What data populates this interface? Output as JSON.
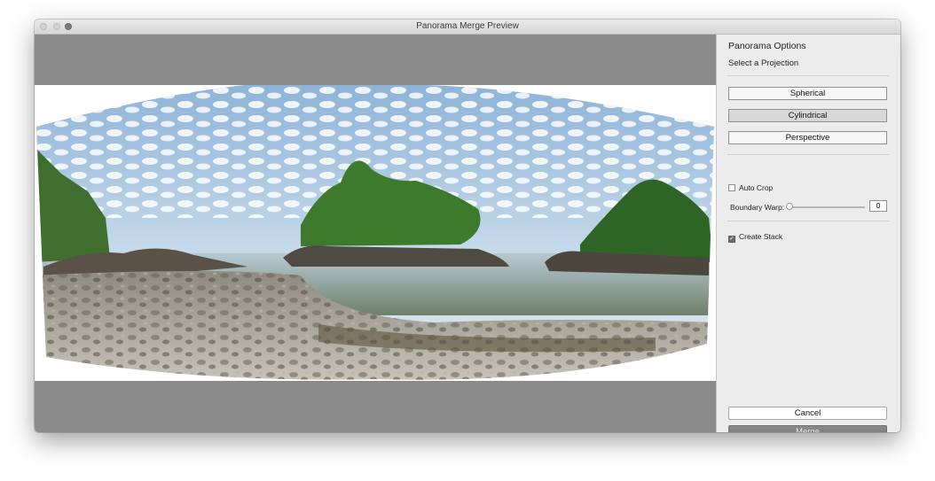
{
  "window": {
    "title": "Panorama Merge Preview"
  },
  "panel": {
    "title": "Panorama Options",
    "subtitle": "Select a Projection",
    "projections": [
      {
        "label": "Spherical",
        "selected": false
      },
      {
        "label": "Cylindrical",
        "selected": true
      },
      {
        "label": "Perspective",
        "selected": false
      }
    ],
    "auto_crop": {
      "label": "Auto Crop",
      "checked": false
    },
    "boundary_warp": {
      "label": "Boundary Warp:",
      "value": "0",
      "slider_fraction": 0
    },
    "create_stack": {
      "label": "Create Stack",
      "checked": true
    },
    "cancel_label": "Cancel",
    "merge_label": "Merge"
  },
  "colors": {
    "preview_background": "#8a8a8a",
    "panel_background": "#ececec"
  }
}
